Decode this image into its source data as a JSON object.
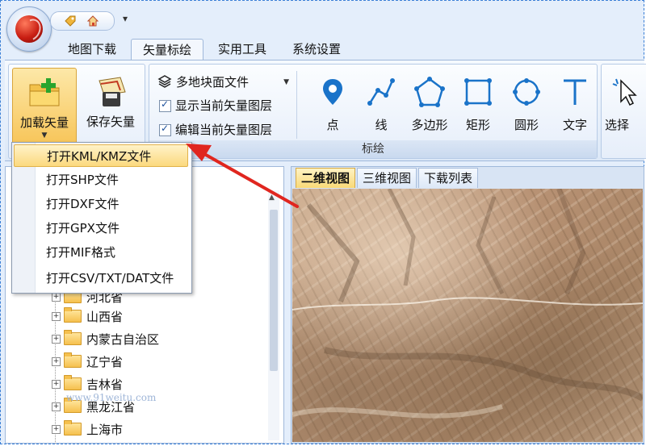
{
  "tabs": [
    "地图下载",
    "矢量标绘",
    "实用工具",
    "系统设置"
  ],
  "ribbon": {
    "load_vector": "加载矢量",
    "save_vector": "保存矢量",
    "layer_combo": "多地块面文件",
    "show_layer": "显示当前矢量图层",
    "edit_layer": "编辑当前矢量图层",
    "tools": [
      "点",
      "线",
      "多边形",
      "矩形",
      "圆形",
      "文字"
    ],
    "group_title": "标绘",
    "select_label": "选择"
  },
  "dropdown": {
    "items": [
      "打开KML/KMZ文件",
      "打开SHP文件",
      "打开DXF文件",
      "打开GPX文件",
      "打开MIF格式",
      "打开CSV/TXT/DAT文件"
    ]
  },
  "map_tabs": [
    "二维视图",
    "三维视图",
    "下载列表"
  ],
  "tree": {
    "items": [
      "河北省",
      "山西省",
      "内蒙古自治区",
      "辽宁省",
      "吉林省",
      "黑龙江省",
      "上海市"
    ]
  },
  "watermark": "www.91weitu.com",
  "colors": {
    "arrow": "#e0261f",
    "highlight": "#fbd97e",
    "accent": "#1a73c9"
  }
}
